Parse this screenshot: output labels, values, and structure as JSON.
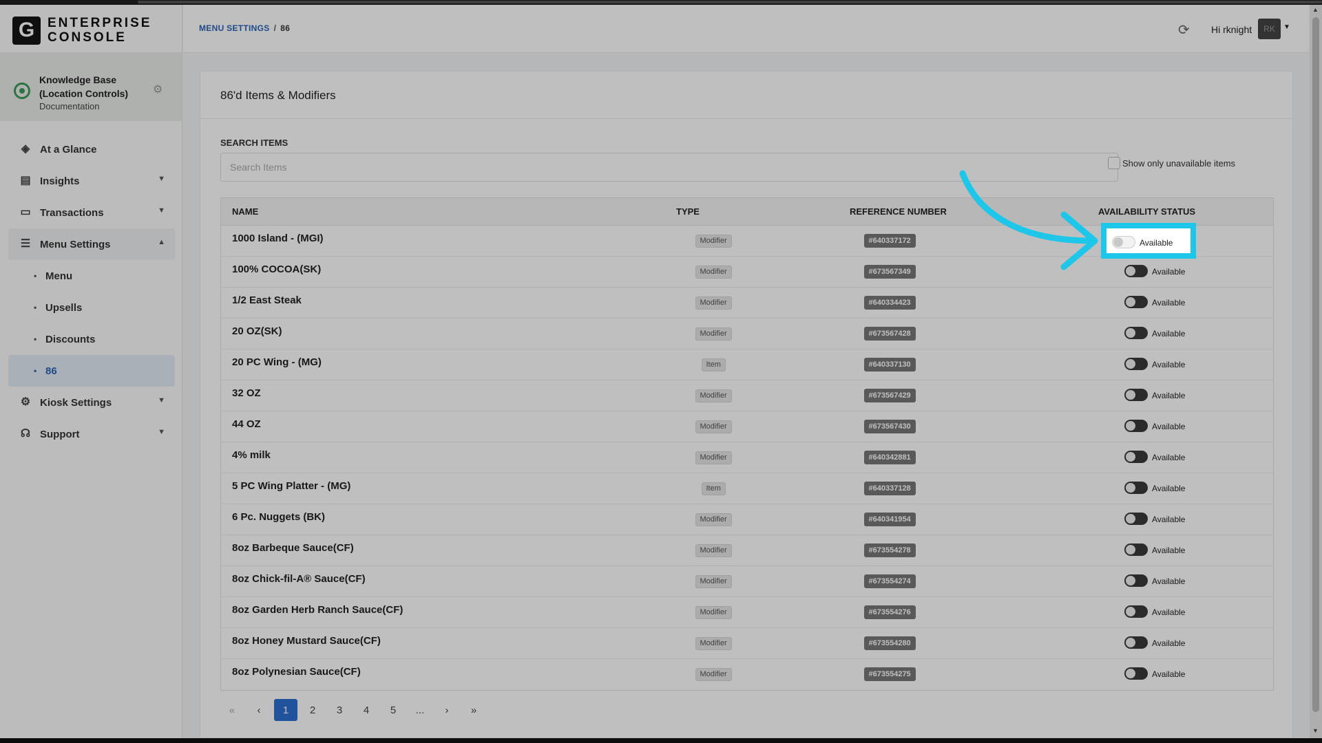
{
  "app": {
    "logo_letter": "G",
    "logo_line1": "ENTERPRISE",
    "logo_line2": "CONSOLE"
  },
  "org": {
    "name": "Knowledge Base (Location Controls)",
    "sub": "Documentation"
  },
  "nav": {
    "at_a_glance": "At a Glance",
    "insights": "Insights",
    "transactions": "Transactions",
    "menu_settings": "Menu Settings",
    "menu": "Menu",
    "upsells": "Upsells",
    "discounts": "Discounts",
    "eighty_six": "86",
    "kiosk_settings": "Kiosk Settings",
    "support": "Support"
  },
  "header": {
    "breadcrumb_root": "MENU SETTINGS",
    "breadcrumb_sep": "/",
    "breadcrumb_current": "86",
    "greeting": "Hi rknight",
    "avatar": "RK"
  },
  "card": {
    "title": "86'd Items & Modifiers",
    "search_label": "SEARCH ITEMS",
    "search_placeholder": "Search Items",
    "show_unavailable_label": "Show only unavailable items"
  },
  "table": {
    "headers": [
      "NAME",
      "TYPE",
      "REFERENCE NUMBER",
      "AVAILABILITY STATUS"
    ],
    "rows": [
      {
        "name": "1000 Island - (MGI)",
        "type": "Modifier",
        "ref": "#640337172",
        "status": "Available"
      },
      {
        "name": "100% COCOA(SK)",
        "type": "Modifier",
        "ref": "#673567349",
        "status": "Available"
      },
      {
        "name": "1/2 East Steak",
        "type": "Modifier",
        "ref": "#640334423",
        "status": "Available"
      },
      {
        "name": "20 OZ(SK)",
        "type": "Modifier",
        "ref": "#673567428",
        "status": "Available"
      },
      {
        "name": "20 PC Wing - (MG)",
        "type": "Item",
        "ref": "#640337130",
        "status": "Available"
      },
      {
        "name": "32 OZ",
        "type": "Modifier",
        "ref": "#673567429",
        "status": "Available"
      },
      {
        "name": "44 OZ",
        "type": "Modifier",
        "ref": "#673567430",
        "status": "Available"
      },
      {
        "name": "4% milk",
        "type": "Modifier",
        "ref": "#640342881",
        "status": "Available"
      },
      {
        "name": "5 PC Wing Platter - (MG)",
        "type": "Item",
        "ref": "#640337128",
        "status": "Available"
      },
      {
        "name": "6 Pc. Nuggets (BK)",
        "type": "Modifier",
        "ref": "#640341954",
        "status": "Available"
      },
      {
        "name": "8oz Barbeque Sauce(CF)",
        "type": "Modifier",
        "ref": "#673554278",
        "status": "Available"
      },
      {
        "name": "8oz Chick-fil-A® Sauce(CF)",
        "type": "Modifier",
        "ref": "#673554274",
        "status": "Available"
      },
      {
        "name": "8oz Garden Herb Ranch Sauce(CF)",
        "type": "Modifier",
        "ref": "#673554276",
        "status": "Available"
      },
      {
        "name": "8oz Honey Mustard Sauce(CF)",
        "type": "Modifier",
        "ref": "#673554280",
        "status": "Available"
      },
      {
        "name": "8oz Polynesian Sauce(CF)",
        "type": "Modifier",
        "ref": "#673554275",
        "status": "Available"
      }
    ]
  },
  "pager": {
    "first": "«",
    "prev": "‹",
    "pages": [
      "1",
      "2",
      "3",
      "4",
      "5"
    ],
    "ellipsis": "...",
    "next": "›",
    "last": "»",
    "current": "1"
  },
  "colors": {
    "accent": "#2b6fd0",
    "highlight": "#1ec7e9",
    "brand_green": "#3c9a56"
  }
}
